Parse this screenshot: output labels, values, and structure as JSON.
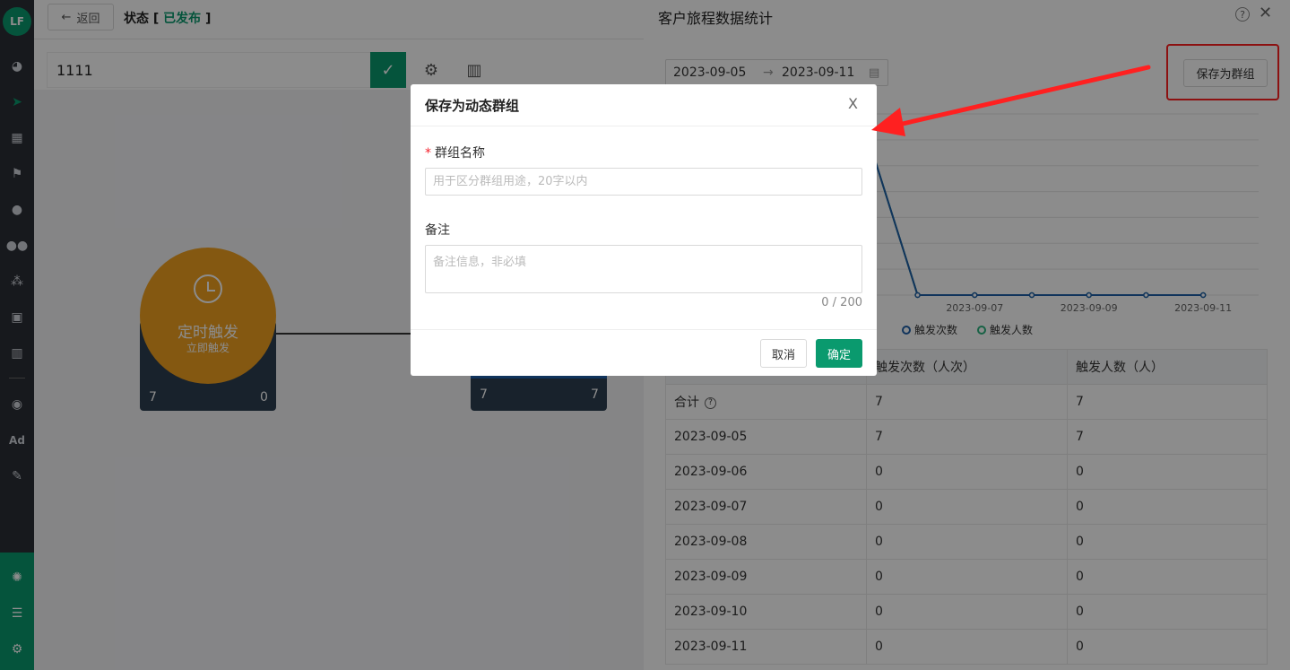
{
  "sidebar": {
    "logo": "LF",
    "icons": [
      "dashboard-icon",
      "send-icon",
      "layout-icon",
      "flag-icon",
      "user-icon",
      "users-icon",
      "segments-icon",
      "bookmark-icon",
      "bar-chart-icon",
      "wechat-icon",
      "ad-icon",
      "wrench-icon"
    ],
    "ad_label": "Ad",
    "bottom_icons": [
      "network-icon",
      "server-icon",
      "gear-icon"
    ]
  },
  "editor": {
    "back_label": "返回",
    "status_prefix": "状态 [",
    "status_value": "已发布",
    "status_suffix": "]",
    "journey_name": "1111",
    "node": {
      "title": "定时触发",
      "subtitle": "立即触发",
      "left_count": "7",
      "right_count": "0"
    },
    "node2": {
      "left_count": "7",
      "right_count": "7"
    }
  },
  "drawer": {
    "title": "客户旅程数据统计",
    "date_start": "2023-09-05",
    "date_end": "2023-09-11",
    "date_sep": "→",
    "save_group_label": "保存为群组",
    "legend": [
      {
        "name": "触发次数",
        "color": "#1f5fa8"
      },
      {
        "name": "触发人数",
        "color": "#2db37f"
      }
    ],
    "table": {
      "headers": [
        "",
        "触发次数（人次）",
        "触发人数（人）"
      ],
      "total_label": "合计",
      "rows": [
        [
          "合计",
          "7",
          "7"
        ],
        [
          "2023-09-05",
          "7",
          "7"
        ],
        [
          "2023-09-06",
          "0",
          "0"
        ],
        [
          "2023-09-07",
          "0",
          "0"
        ],
        [
          "2023-09-08",
          "0",
          "0"
        ],
        [
          "2023-09-09",
          "0",
          "0"
        ],
        [
          "2023-09-10",
          "0",
          "0"
        ],
        [
          "2023-09-11",
          "0",
          "0"
        ]
      ]
    }
  },
  "chart_data": {
    "type": "line",
    "x": [
      "2023-09-05",
      "2023-09-06",
      "2023-09-07",
      "2023-09-08",
      "2023-09-09",
      "2023-09-10",
      "2023-09-11"
    ],
    "x_tick_labels": [
      "2023-09-07",
      "2023-09-09",
      "2023-09-11"
    ],
    "series": [
      {
        "name": "触发次数",
        "values": [
          7,
          0,
          0,
          0,
          0,
          0,
          0
        ]
      },
      {
        "name": "触发人数",
        "values": [
          7,
          0,
          0,
          0,
          0,
          0,
          0
        ]
      }
    ],
    "grid": true,
    "legend": "bottom"
  },
  "modal": {
    "title": "保存为动态群组",
    "close": "X",
    "name_label": "群组名称",
    "name_required": "*",
    "name_placeholder": "用于区分群组用途，20字以内",
    "name_value": "",
    "note_label": "备注",
    "note_placeholder": "备注信息，非必填",
    "note_value": "",
    "counter": "0 / 200",
    "cancel_label": "取消",
    "ok_label": "确定"
  },
  "colors": {
    "brand": "#0a9a6e",
    "annotation": "#ff2020",
    "node_orange": "#f0a020"
  }
}
